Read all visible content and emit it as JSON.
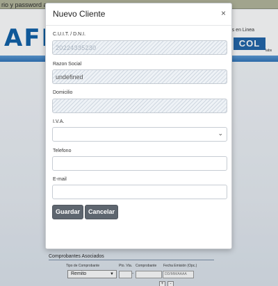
{
  "background": {
    "topbar_text": "rio y password a",
    "logo_text": "AFI",
    "tagline": "ntes en Linea",
    "brand_box": "COL",
    "brand_sub": "labs",
    "section_title": "Comprobantes Asociados",
    "columns": {
      "tipo": "Tipo de Comprobante",
      "pto_vta": "Pto. Vta.",
      "comprobante": "Comprobante",
      "fecha": "Fecha Emisión (Opc.)"
    },
    "tipo_select_value": "Remito",
    "fecha_placeholder": "DD/MM/AAAA",
    "dash": "-",
    "add_btn": "+",
    "remove_btn": "-"
  },
  "modal": {
    "title": "Nuevo Cliente",
    "close_symbol": "×",
    "fields": {
      "cuit": {
        "label": "C.U.I.T. / D.N.I.",
        "value": "20224335230"
      },
      "razon_social": {
        "label": "Razon Social",
        "value": "undefined"
      },
      "domicilio": {
        "label": "Domicilio",
        "value": ""
      },
      "iva": {
        "label": "I.V.A.",
        "value": ""
      },
      "telefono": {
        "label": "Telefono",
        "value": ""
      },
      "email": {
        "label": "E-mail",
        "value": ""
      }
    },
    "buttons": {
      "guardar": "Guardar",
      "cancelar": "Cancelar"
    }
  },
  "colors": {
    "primary_button": "#5e666f",
    "brand_blue": "#0d5fa7",
    "header_band": "#2f73b8"
  },
  "icons": {
    "close": "close-icon",
    "select_arrow": "chevron-down-icon"
  }
}
